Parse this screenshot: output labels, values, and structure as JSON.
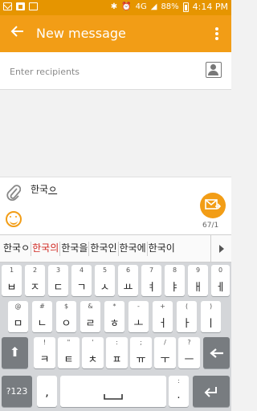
{
  "status_bar": {
    "network": "4G",
    "battery": "88%",
    "time": "4:14 PM"
  },
  "app_bar": {
    "title": "New message"
  },
  "recipients": {
    "placeholder": "Enter recipients"
  },
  "compose": {
    "text_plain": "한국",
    "text_composing": "ㅇ",
    "counter": "67/1"
  },
  "suggestions": [
    "한국ㅇ",
    "한국의",
    "한국을",
    "한국인",
    "한국에",
    "한국이"
  ],
  "suggestion_highlight_index": 1,
  "keyboard": {
    "row1": [
      {
        "sub": "1",
        "main": "ㅂ"
      },
      {
        "sub": "2",
        "main": "ㅈ"
      },
      {
        "sub": "3",
        "main": "ㄷ"
      },
      {
        "sub": "4",
        "main": "ㄱ"
      },
      {
        "sub": "5",
        "main": "ㅅ"
      },
      {
        "sub": "6",
        "main": "ㅛ"
      },
      {
        "sub": "7",
        "main": "ㅕ"
      },
      {
        "sub": "8",
        "main": "ㅑ"
      },
      {
        "sub": "9",
        "main": "ㅐ"
      },
      {
        "sub": "0",
        "main": "ㅔ"
      }
    ],
    "row2": [
      {
        "sub": "@",
        "main": "ㅁ"
      },
      {
        "sub": "#",
        "main": "ㄴ"
      },
      {
        "sub": "$",
        "main": "ㅇ"
      },
      {
        "sub": "&",
        "main": "ㄹ"
      },
      {
        "sub": "*",
        "main": "ㅎ"
      },
      {
        "sub": "-",
        "main": "ㅗ"
      },
      {
        "sub": "+",
        "main": "ㅓ"
      },
      {
        "sub": "(",
        "main": "ㅏ"
      },
      {
        "sub": ")",
        "main": "ㅣ"
      }
    ],
    "row3": [
      {
        "sub": "!",
        "main": "ㅋ"
      },
      {
        "sub": "\"",
        "main": "ㅌ"
      },
      {
        "sub": "'",
        "main": "ㅊ"
      },
      {
        "sub": ":",
        "main": "ㅍ"
      },
      {
        "sub": ";",
        "main": "ㅠ"
      },
      {
        "sub": "/",
        "main": "ㅜ"
      },
      {
        "sub": "?",
        "main": "ㅡ"
      }
    ],
    "symbols_label": "?123",
    "comma": ",",
    "period": ".",
    "period_sub": ":"
  }
}
